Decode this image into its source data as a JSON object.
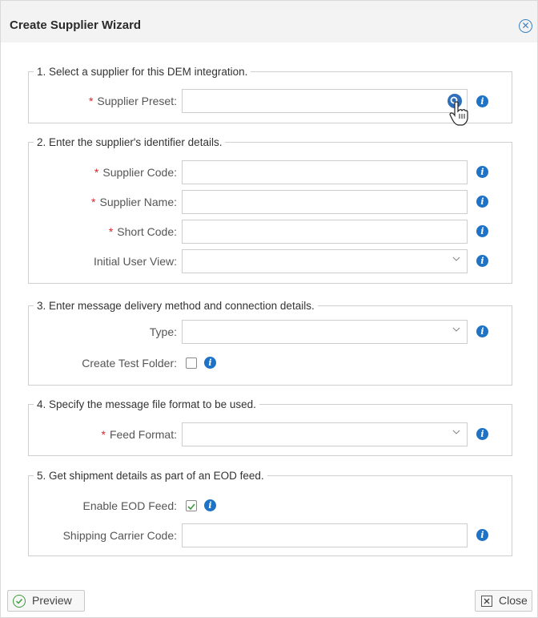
{
  "dialog": {
    "title": "Create Supplier Wizard",
    "close_icon": "circle-x-icon"
  },
  "sections": {
    "s1": {
      "legend": "1. Select a supplier for this DEM integration.",
      "supplier_preset_label": "Supplier Preset:",
      "supplier_preset_value": ""
    },
    "s2": {
      "legend": "2. Enter the supplier's identifier details.",
      "supplier_code_label": "Supplier Code:",
      "supplier_name_label": "Supplier Name:",
      "short_code_label": "Short Code:",
      "initial_user_view_label": "Initial User View:",
      "supplier_code_value": "",
      "supplier_name_value": "",
      "short_code_value": "",
      "initial_user_view_value": ""
    },
    "s3": {
      "legend": "3. Enter message delivery method and connection details.",
      "type_label": "Type:",
      "type_value": "",
      "create_test_folder_label": "Create Test Folder:",
      "create_test_folder_checked": false
    },
    "s4": {
      "legend": "4. Specify the message file format to be used.",
      "feed_format_label": "Feed Format:",
      "feed_format_value": ""
    },
    "s5": {
      "legend": "5. Get shipment details as part of an EOD feed.",
      "enable_eod_label": "Enable EOD Feed:",
      "enable_eod_checked": true,
      "shipping_carrier_code_label": "Shipping Carrier Code:",
      "shipping_carrier_code_value": ""
    }
  },
  "required_marker": "*",
  "info_glyph": "i",
  "footer": {
    "preview_label": "Preview",
    "close_label": "Close"
  },
  "colors": {
    "accent": "#1f73c6",
    "required": "#d9252d",
    "titlebar_bg": "#f3f3f3"
  }
}
